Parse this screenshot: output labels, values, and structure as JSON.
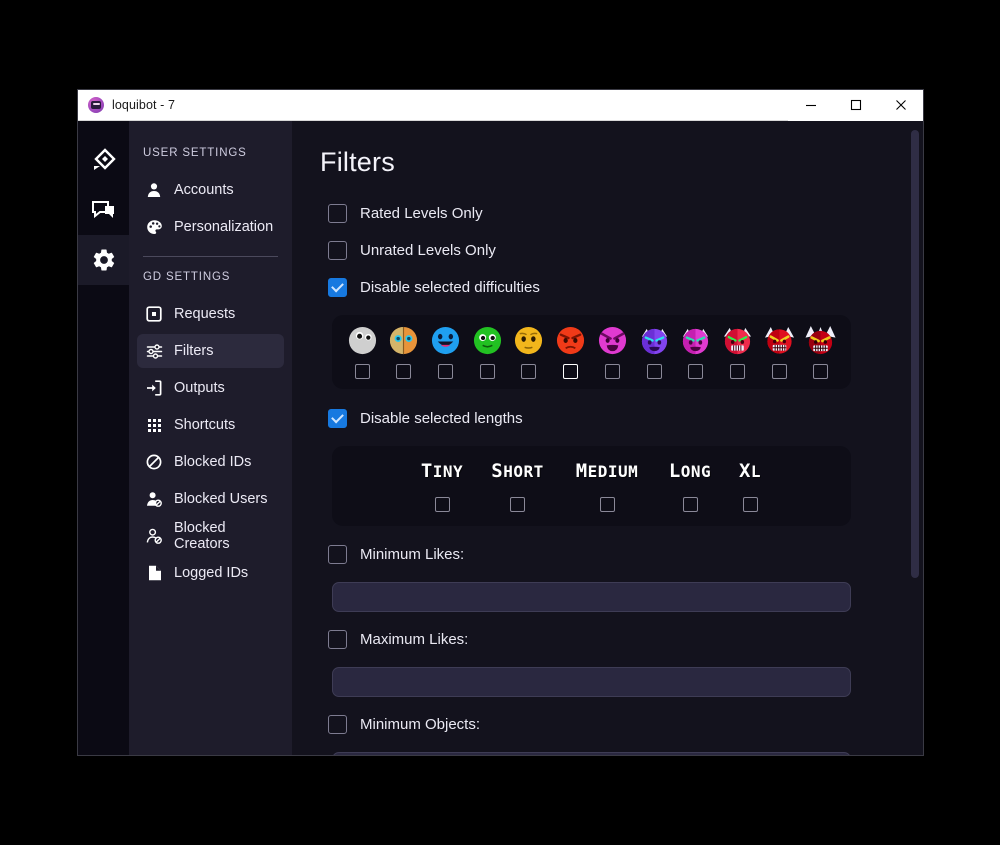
{
  "window": {
    "title": "loquibot - 7",
    "app_icon": "robot-avatar-icon",
    "controls": {
      "minimize": "minimize",
      "maximize": "maximize",
      "close": "close"
    }
  },
  "rail": {
    "items": [
      {
        "id": "levels",
        "icon": "diamond-level-icon",
        "active": false
      },
      {
        "id": "chat",
        "icon": "chat-bubbles-icon",
        "active": false
      },
      {
        "id": "settings",
        "icon": "gear-icon",
        "active": true
      }
    ]
  },
  "sidebar": {
    "groups": [
      {
        "heading": "USER SETTINGS",
        "items": [
          {
            "label": "Accounts",
            "icon": "person-icon",
            "active": false
          },
          {
            "label": "Personalization",
            "icon": "palette-icon",
            "active": false
          }
        ]
      },
      {
        "heading": "GD SETTINGS",
        "items": [
          {
            "label": "Requests",
            "icon": "inbox-square-icon",
            "active": false
          },
          {
            "label": "Filters",
            "icon": "sliders-icon",
            "active": true
          },
          {
            "label": "Outputs",
            "icon": "export-arrow-icon",
            "active": false
          },
          {
            "label": "Shortcuts",
            "icon": "grid-dots-icon",
            "active": false
          },
          {
            "label": "Blocked IDs",
            "icon": "no-entry-icon",
            "active": false
          },
          {
            "label": "Blocked Users",
            "icon": "person-block-icon",
            "active": false
          },
          {
            "label": "Blocked Creators",
            "icon": "creator-block-icon",
            "active": false
          },
          {
            "label": "Logged IDs",
            "icon": "document-icon",
            "active": false
          }
        ]
      }
    ]
  },
  "main": {
    "title": "Filters",
    "checkboxes": [
      {
        "label": "Rated Levels Only",
        "checked": false
      },
      {
        "label": "Unrated Levels Only",
        "checked": false
      },
      {
        "label": "Disable selected difficulties",
        "checked": true
      }
    ],
    "difficulties": [
      {
        "name": "Auto",
        "checked": false,
        "hover": false
      },
      {
        "name": "NA",
        "checked": false,
        "hover": false
      },
      {
        "name": "Easy",
        "checked": false,
        "hover": false
      },
      {
        "name": "Normal",
        "checked": false,
        "hover": false
      },
      {
        "name": "Hard",
        "checked": false,
        "hover": false
      },
      {
        "name": "Harder",
        "checked": false,
        "hover": true
      },
      {
        "name": "Insane",
        "checked": false,
        "hover": false
      },
      {
        "name": "Easy Demon",
        "checked": false,
        "hover": false
      },
      {
        "name": "Medium Demon",
        "checked": false,
        "hover": false
      },
      {
        "name": "Hard Demon",
        "checked": false,
        "hover": false
      },
      {
        "name": "Insane Demon",
        "checked": false,
        "hover": false
      },
      {
        "name": "Extreme Demon",
        "checked": false,
        "hover": false
      }
    ],
    "lengths_checkbox": {
      "label": "Disable selected lengths",
      "checked": true
    },
    "lengths": [
      {
        "label": "Tiny",
        "checked": false
      },
      {
        "label": "Short",
        "checked": false
      },
      {
        "label": "Medium",
        "checked": false
      },
      {
        "label": "Long",
        "checked": false
      },
      {
        "label": "XL",
        "checked": false
      }
    ],
    "numeric_filters": [
      {
        "label": "Minimum Likes:",
        "checked": false,
        "value": ""
      },
      {
        "label": "Maximum Likes:",
        "checked": false,
        "value": ""
      },
      {
        "label": "Minimum Objects:",
        "checked": false,
        "value": ""
      }
    ]
  },
  "colors": {
    "accent": "#1779e0",
    "window_bg": "#14131f",
    "rail_bg": "#0b0a14",
    "sidebar_bg": "#1e1c2b",
    "main_bg": "#13121d",
    "panel_bg": "#0e0d17",
    "field_bg": "#2a2840",
    "active_nav_bg": "#2c2a3d"
  },
  "scrollbar": {
    "orientation": "vertical",
    "thumb_position": "top"
  }
}
